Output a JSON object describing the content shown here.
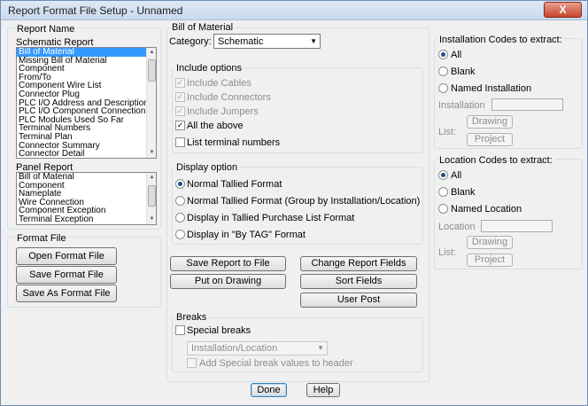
{
  "window": {
    "title": "Report Format File Setup - Unnamed",
    "close_glyph": "X"
  },
  "report_name": {
    "group_label": "Report Name",
    "schematic": {
      "label": "Schematic Report",
      "items": [
        "Bill of Material",
        "Missing Bill of Material",
        "Component",
        "From/To",
        "Component Wire List",
        "Connector Plug",
        "PLC I/O Address and Descriptions",
        "PLC I/O Component Connection",
        "PLC Modules Used So Far",
        "Terminal Numbers",
        "Terminal Plan",
        "Connector Summary",
        "Connector Detail"
      ]
    },
    "panel": {
      "label": "Panel Report",
      "items": [
        "Bill of Material",
        "Component",
        "Nameplate",
        "Wire Connection",
        "Component Exception",
        "Terminal Exception"
      ]
    }
  },
  "format_file": {
    "group_label": "Format File",
    "open_label": "Open Format File",
    "save_label": "Save Format File",
    "save_as_label": "Save As Format File"
  },
  "bom": {
    "group_label": "Bill of Material",
    "category_label": "Category:",
    "category_value": "Schematic",
    "include_options": {
      "label": "Include options",
      "cables": "Include Cables",
      "connectors": "Include Connectors",
      "jumpers": "Include Jumpers",
      "all": "All the above",
      "terminal_numbers": "List terminal numbers"
    },
    "display_option": {
      "label": "Display option",
      "opt1": "Normal Tallied Format",
      "opt2": "Normal Tallied Format (Group by Installation/Location)",
      "opt3": "Display in Tallied Purchase List Format",
      "opt4": "Display in \"By TAG\" Format"
    },
    "buttons": {
      "save_report": "Save Report to File",
      "put_on_drawing": "Put on Drawing",
      "change_fields": "Change Report Fields",
      "sort_fields": "Sort Fields",
      "user_post": "User Post"
    },
    "breaks": {
      "label": "Breaks",
      "special": "Special breaks",
      "combo_value": "Installation/Location",
      "add_header": "Add Special break values to header"
    }
  },
  "installation": {
    "label": "Installation Codes to extract:",
    "all": "All",
    "blank": "Blank",
    "named": "Named Installation",
    "field_label": "Installation",
    "list_label": "List:",
    "drawing": "Drawing",
    "project": "Project"
  },
  "location": {
    "label": "Location Codes to extract:",
    "all": "All",
    "blank": "Blank",
    "named": "Named Location",
    "field_label": "Location",
    "list_label": "List:",
    "drawing": "Drawing",
    "project": "Project"
  },
  "footer": {
    "done": "Done",
    "help": "Help"
  }
}
